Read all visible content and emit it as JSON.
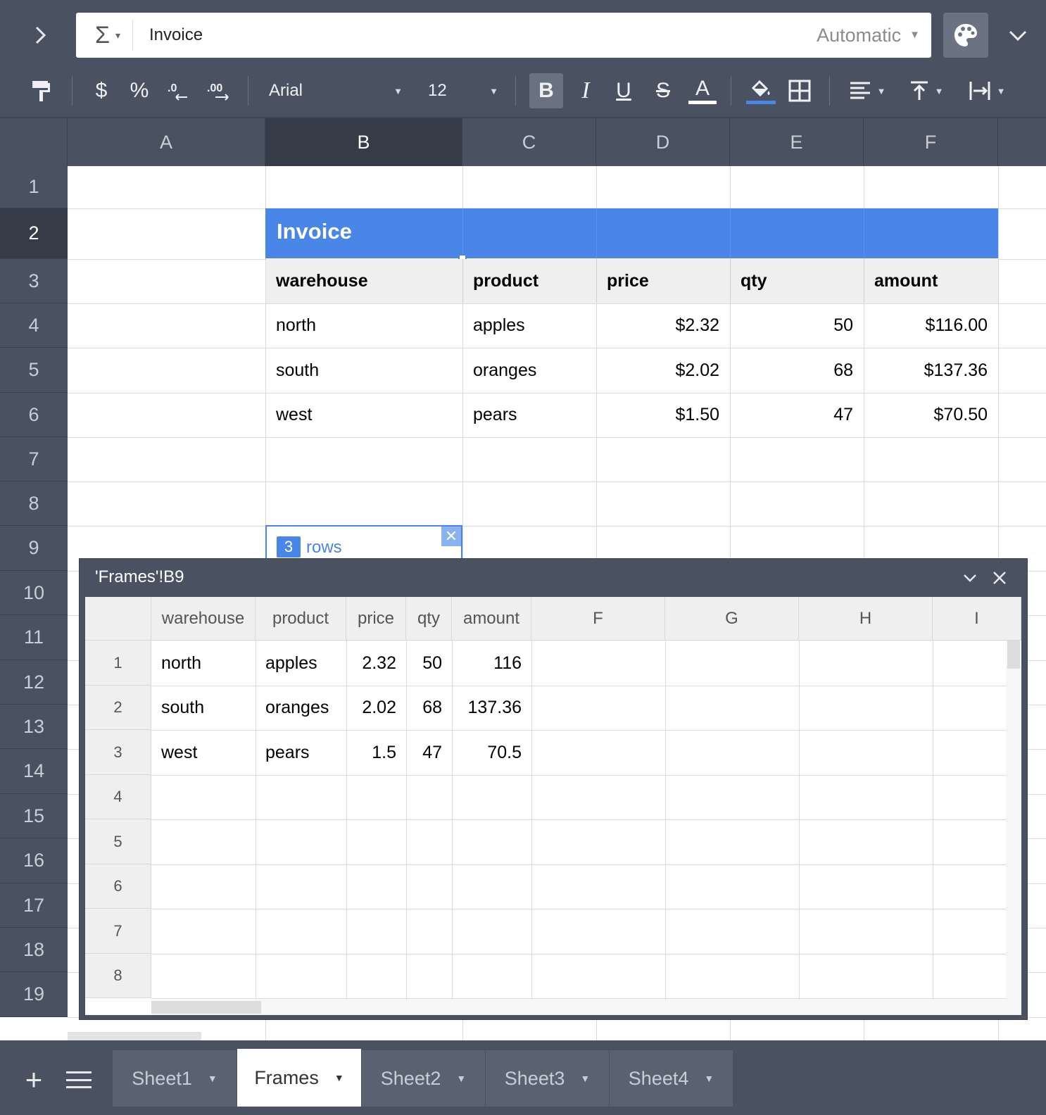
{
  "formula": {
    "func_symbol": "Σ",
    "caret": "▾",
    "value": "Invoice",
    "mode": "Automatic"
  },
  "toolbar": {
    "currency": "$",
    "percent": "%",
    "font": "Arial",
    "size": "12",
    "bold": "B",
    "italic": "I",
    "underline": "U",
    "strike": "S",
    "text_color": "A"
  },
  "grid": {
    "columns": [
      "A",
      "B",
      "C",
      "D",
      "E",
      "F"
    ],
    "rows": [
      "1",
      "2",
      "3",
      "4",
      "5",
      "6",
      "7",
      "8",
      "9",
      "10",
      "11",
      "12",
      "13",
      "14",
      "15",
      "16",
      "17",
      "18",
      "19"
    ],
    "invoice_title": "Invoice",
    "headers": [
      "warehouse",
      "product",
      "price",
      "qty",
      "amount"
    ],
    "data": [
      [
        "north",
        "apples",
        "$2.32",
        "50",
        "$116.00"
      ],
      [
        "south",
        "oranges",
        "$2.02",
        "68",
        "$137.36"
      ],
      [
        "west",
        "pears",
        "$1.50",
        "47",
        "$70.50"
      ]
    ],
    "frame_count": "3",
    "frame_label": "rows"
  },
  "frame_panel": {
    "title": "'Frames'!B9",
    "columns": [
      "warehouse",
      "product",
      "price",
      "qty",
      "amount",
      "F",
      "G",
      "H",
      "I"
    ],
    "rows": [
      "1",
      "2",
      "3",
      "4",
      "5",
      "6",
      "7",
      "8"
    ],
    "data": [
      [
        "north",
        "apples",
        "2.32",
        "50",
        "116"
      ],
      [
        "south",
        "oranges",
        "2.02",
        "68",
        "137.36"
      ],
      [
        "west",
        "pears",
        "1.5",
        "47",
        "70.5"
      ]
    ]
  },
  "tabs": [
    {
      "label": "Sheet1",
      "active": false
    },
    {
      "label": "Frames",
      "active": true
    },
    {
      "label": "Sheet2",
      "active": false
    },
    {
      "label": "Sheet3",
      "active": false
    },
    {
      "label": "Sheet4",
      "active": false
    }
  ],
  "colors": {
    "chrome": "#4a5262",
    "accent": "#4a86e8"
  }
}
